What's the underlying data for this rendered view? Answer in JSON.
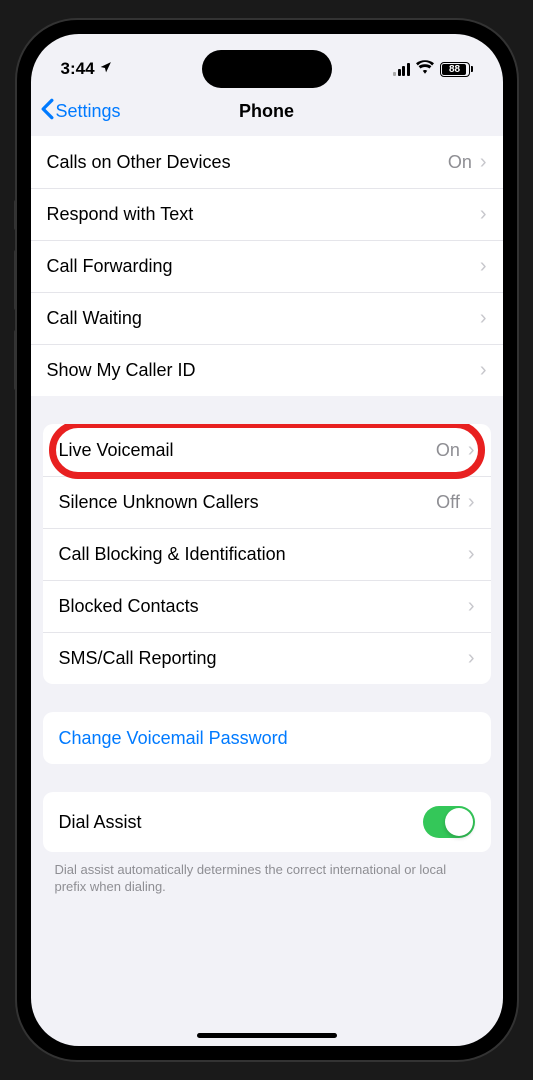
{
  "status": {
    "time": "3:44",
    "battery": "88"
  },
  "nav": {
    "back": "Settings",
    "title": "Phone"
  },
  "section1": {
    "items": [
      {
        "label": "Calls on Other Devices",
        "value": "On"
      },
      {
        "label": "Respond with Text",
        "value": ""
      },
      {
        "label": "Call Forwarding",
        "value": ""
      },
      {
        "label": "Call Waiting",
        "value": ""
      },
      {
        "label": "Show My Caller ID",
        "value": ""
      }
    ]
  },
  "section2": {
    "items": [
      {
        "label": "Live Voicemail",
        "value": "On"
      },
      {
        "label": "Silence Unknown Callers",
        "value": "Off"
      },
      {
        "label": "Call Blocking & Identification",
        "value": ""
      },
      {
        "label": "Blocked Contacts",
        "value": ""
      },
      {
        "label": "SMS/Call Reporting",
        "value": ""
      }
    ]
  },
  "section3": {
    "link": "Change Voicemail Password"
  },
  "section4": {
    "label": "Dial Assist",
    "footer": "Dial assist automatically determines the correct international or local prefix when dialing."
  }
}
